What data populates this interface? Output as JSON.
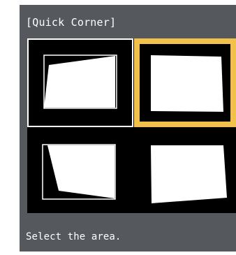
{
  "dialog": {
    "title": "[Quick Corner]",
    "status": "Select the area.",
    "selected_area": "top-right"
  },
  "areas": [
    {
      "name": "top-left"
    },
    {
      "name": "top-right"
    },
    {
      "name": "bottom-left"
    },
    {
      "name": "bottom-right"
    }
  ],
  "colors": {
    "panel": "#55585d",
    "selection": "#f1c14b",
    "cell_background": "#000000",
    "shape_fill": "#ffffff"
  }
}
